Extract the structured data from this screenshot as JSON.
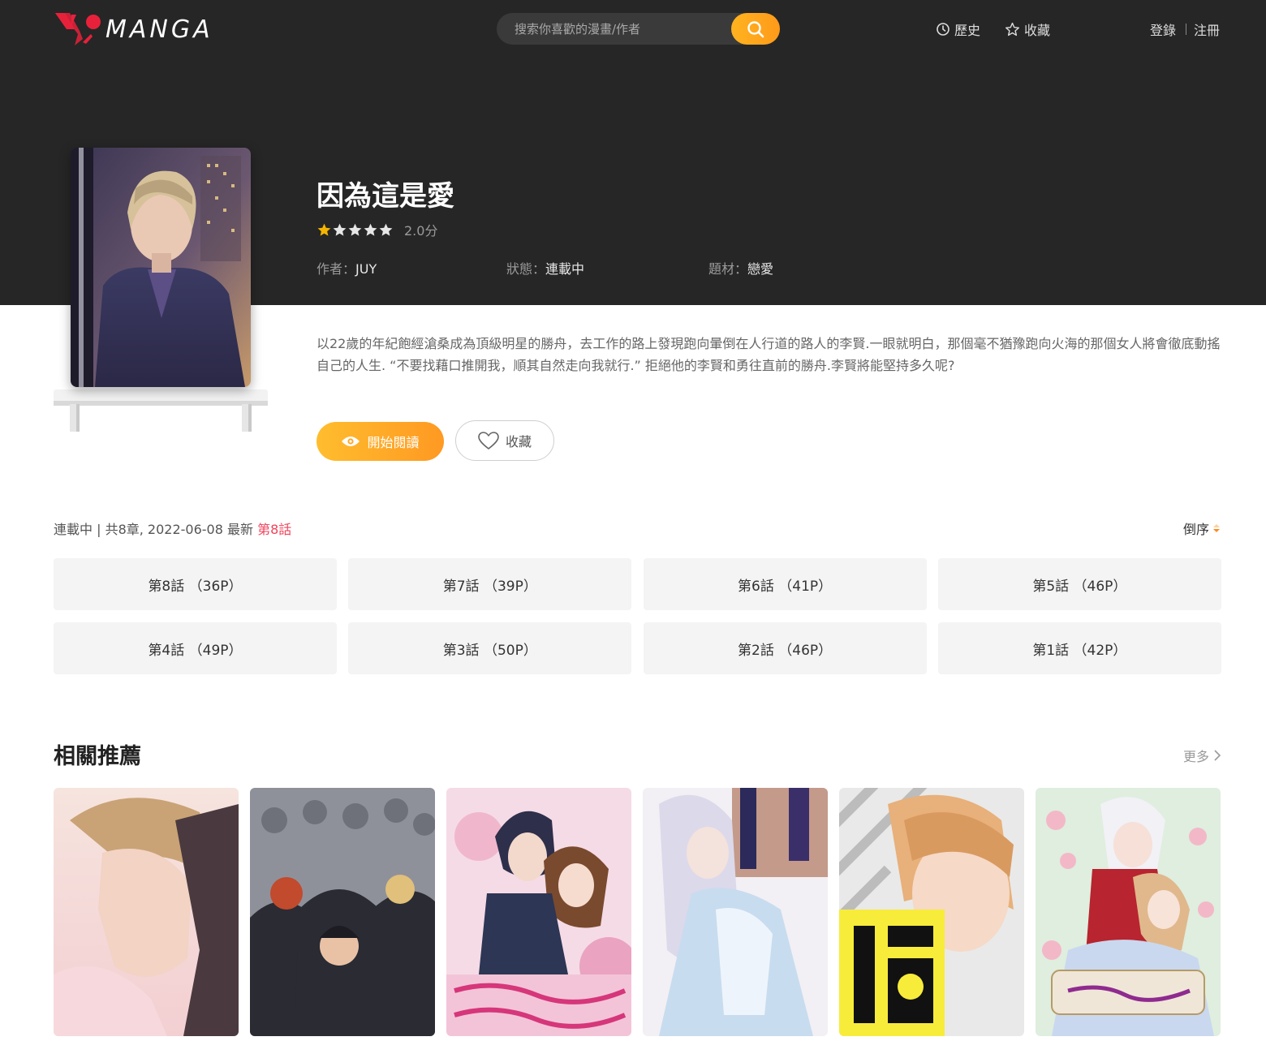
{
  "header": {
    "logo_text": "MANGA",
    "search_placeholder": "搜索你喜歡的漫畫/作者",
    "nav_history": "歷史",
    "nav_favorites": "收藏",
    "nav_login": "登錄",
    "nav_register": "注冊"
  },
  "comic": {
    "title": "因為這是愛",
    "stars_filled": 1,
    "stars_total": 5,
    "score": "2.0分",
    "author_label": "作者：",
    "author": "JUY",
    "status_label": "狀態：",
    "status": "連載中",
    "genre_label": "題材：",
    "genre": "戀愛",
    "description": "以22歲的年紀飽經滄桑成為頂級明星的勝舟，去工作的路上發現跑向暈倒在人行道的路人的李賢.一眼就明白，那個毫不猶豫跑向火海的那個女人將會徹底動搖自己的人生. “不要找藉口推開我，順其自然走向我就行.” 拒絕他的李賢和勇往直前的勝舟.李賢將能堅持多久呢?",
    "read_button": "開始閱讀",
    "fav_button": "收藏"
  },
  "chapters": {
    "info_prefix": "連載中 | 共8章, 2022-06-08 最新 ",
    "latest": "第8話",
    "sort_label": "倒序",
    "items": [
      "第8話 （36P）",
      "第7話 （39P）",
      "第6話 （41P）",
      "第5話 （46P）",
      "第4話 （49P）",
      "第3話 （50P）",
      "第2話 （46P）",
      "第1話 （42P）"
    ]
  },
  "related": {
    "title": "相關推薦",
    "more": "更多"
  },
  "colors": {
    "hero_bg": "#262626",
    "accent_orange": "#ff9a1a",
    "latest_red": "#f0425b",
    "star_gold": "#f5b400",
    "chapter_bg": "#f4f4f4"
  }
}
